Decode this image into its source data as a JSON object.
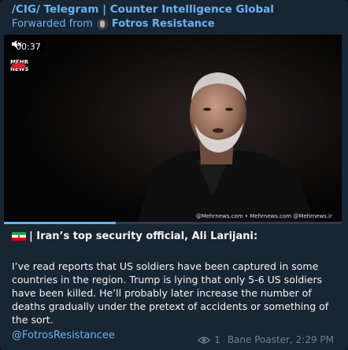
{
  "header": {
    "title": "/CIG/ Telegram | Counter Intelligence Global",
    "forwarded_label": "Forwarded from",
    "forwarded_source": "Fotros Resistance"
  },
  "video": {
    "duration": "00:37",
    "muted": true,
    "logo_text_1": "MEHR",
    "logo_text_2": "NEWS",
    "watermark": "@Mehrnews.com  • Mehrnews.com  @Mehrnews.ir",
    "progress_fraction": 0.33
  },
  "post": {
    "flag": "iran-flag",
    "headline": "| Iran’s top security official, Ali Larijani:",
    "body": "I’ve read reports that US soldiers have been captured in some countries in the region. Trump is lying that only 5-6 US soldiers have been killed. He’ll probably later increase the number of deaths gradually under the pretext of accidents or something of the sort.",
    "link": "@FotrosResistancee"
  },
  "meta": {
    "views": "1",
    "author": "Bane Poaster,",
    "time": "2:29 PM"
  },
  "colors": {
    "background": "#182533",
    "accent": "#6ab3f3",
    "text": "#f5f5f5",
    "meta": "#6d7f8f"
  }
}
